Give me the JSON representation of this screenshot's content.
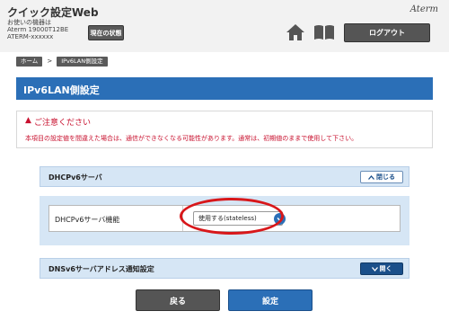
{
  "header": {
    "title": "クイック設定Web",
    "device_label": "お使いの機器は",
    "device_model": "Aterm 19000T12BE",
    "device_id": "ATERM-xxxxxx",
    "status_button": "現在の状態",
    "brand": "Aterm",
    "logout_button": "ログアウト"
  },
  "breadcrumb": {
    "home": "ホーム",
    "separator": ">",
    "current": "IPv6LAN側設定"
  },
  "page": {
    "title": "IPv6LAN側設定"
  },
  "warning": {
    "icon": "▲",
    "title": "ご注意ください",
    "text": "本項目の設定値を間違えた場合は、通信ができなくなる可能性があります。通常は、初期値のままで使用して下さい。"
  },
  "sections": {
    "dhcpv6": {
      "title": "DHCPv6サーバ",
      "toggle": "閉じる",
      "field_label": "DHCPv6サーバ機能",
      "field_value": "使用する(stateless)"
    },
    "dns": {
      "title": "DNSv6サーバアドレス通知設定",
      "toggle": "開く"
    }
  },
  "footer": {
    "back_button": "戻る",
    "set_button": "設定"
  },
  "colors": {
    "accent": "#2b6fb7",
    "warning": "#c8102e",
    "highlight": "#d8171a"
  }
}
